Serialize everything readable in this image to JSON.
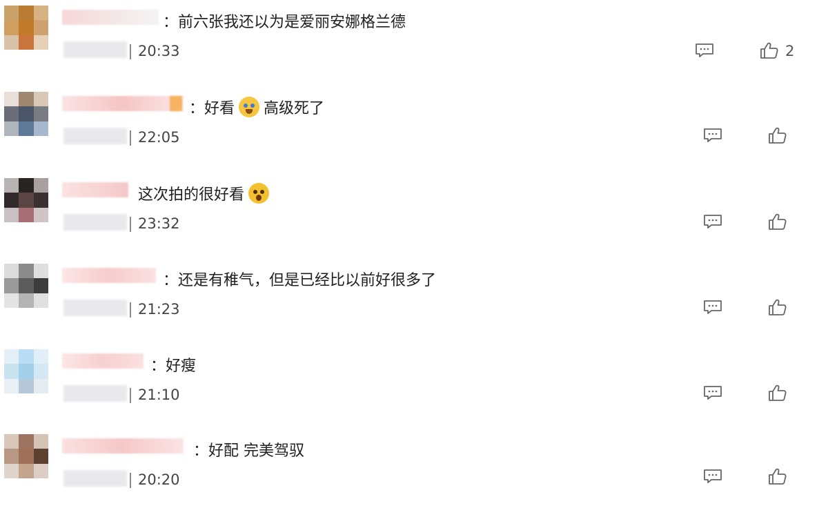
{
  "comments": [
    {
      "text": "：前六张我还以为是爱丽安娜格兰德",
      "time": "20:33",
      "likes": "2"
    },
    {
      "text_before": "：好看",
      "emoji": "crying-face-emoji",
      "text_after": "高级死了",
      "time": "22:05"
    },
    {
      "text_before": "这次拍的很好看",
      "emoji": "shocked-face-emoji",
      "time": "23:32"
    },
    {
      "text": "：还是有稚气，但是已经比以前好很多了",
      "time": "21:23"
    },
    {
      "text": "：好瘦",
      "time": "21:10"
    },
    {
      "text": "：好配 完美驾驭",
      "time": "20:20"
    }
  ],
  "icons": {
    "reply": "comment-bubble-icon",
    "like": "thumbs-up-icon"
  },
  "colors": {
    "text": "#1f1f1f",
    "icon": "#666666",
    "blur_pink": "#f8d4d4",
    "blur_gray": "#e9e9ed"
  }
}
